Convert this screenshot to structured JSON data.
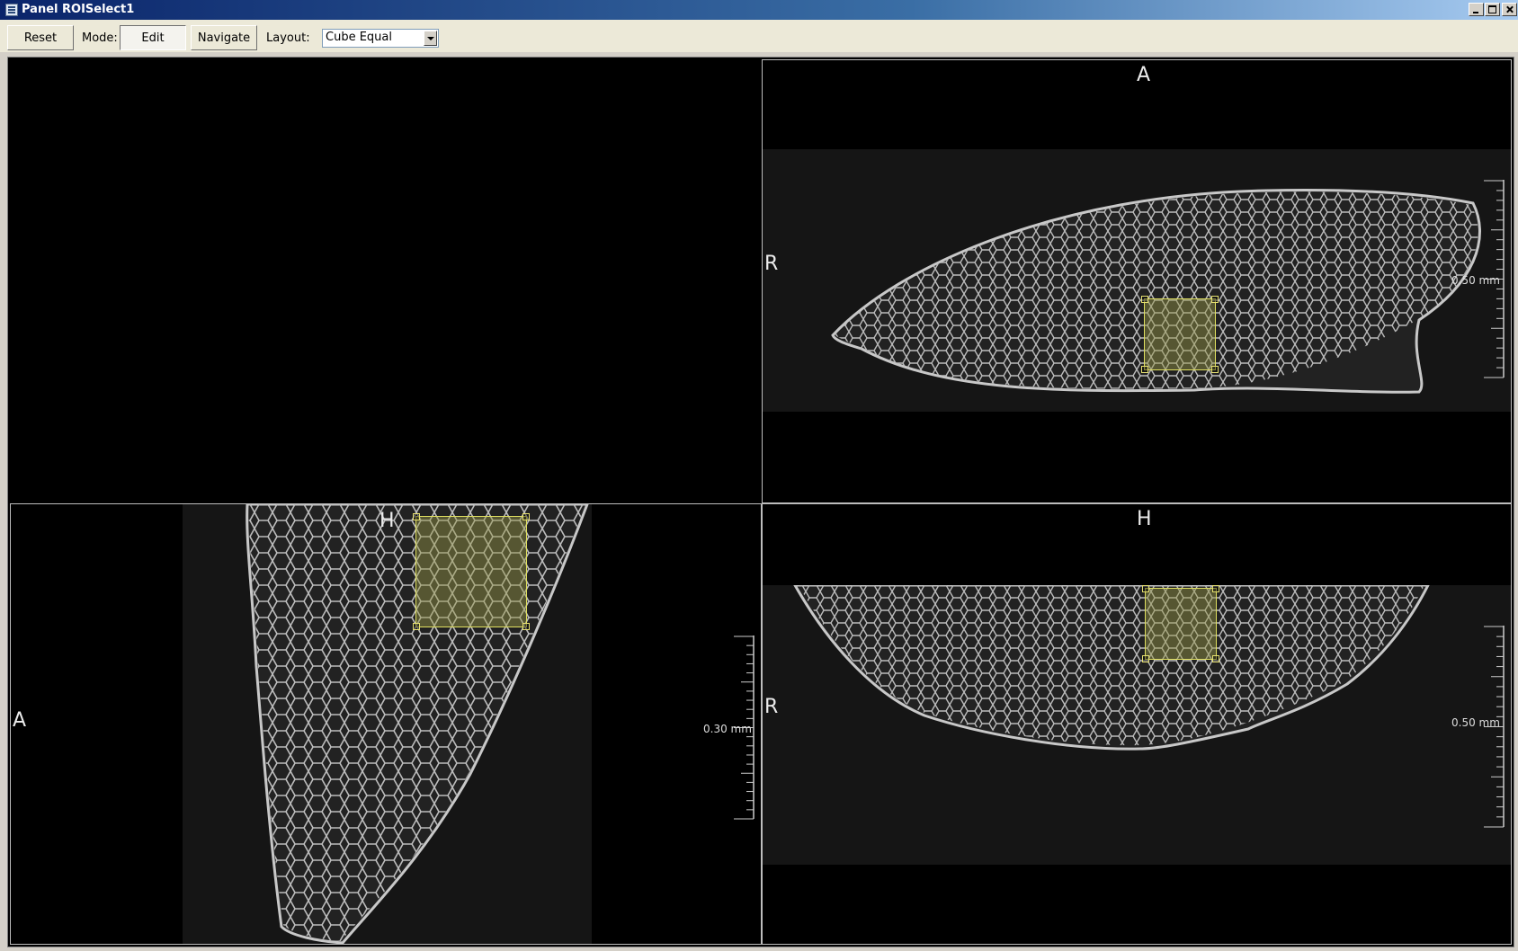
{
  "window": {
    "title": "Panel ROISelect1",
    "icon": "app-window-icon",
    "controls": [
      "minimize-icon",
      "maximize-icon",
      "close-icon"
    ]
  },
  "toolbar": {
    "reset_label": "Reset",
    "mode_label": "Mode:",
    "edit_label": "Edit",
    "navigate_label": "Navigate",
    "layout_label": "Layout:",
    "layout_value": "Cube Equal",
    "active_mode": "Edit"
  },
  "views": {
    "axial": {
      "top": "A",
      "left": "R",
      "scale": "0.50 mm"
    },
    "sagittal": {
      "top": "H",
      "left": "A",
      "scale": "0.30 mm"
    },
    "coronal": {
      "top": "H",
      "left": "R",
      "scale": "0.50 mm"
    }
  },
  "colors": {
    "roi_fill": "#96964680",
    "roi_border": "#e0e060",
    "viewport_bg": "#000000",
    "tissue": "#bcbcbc"
  }
}
